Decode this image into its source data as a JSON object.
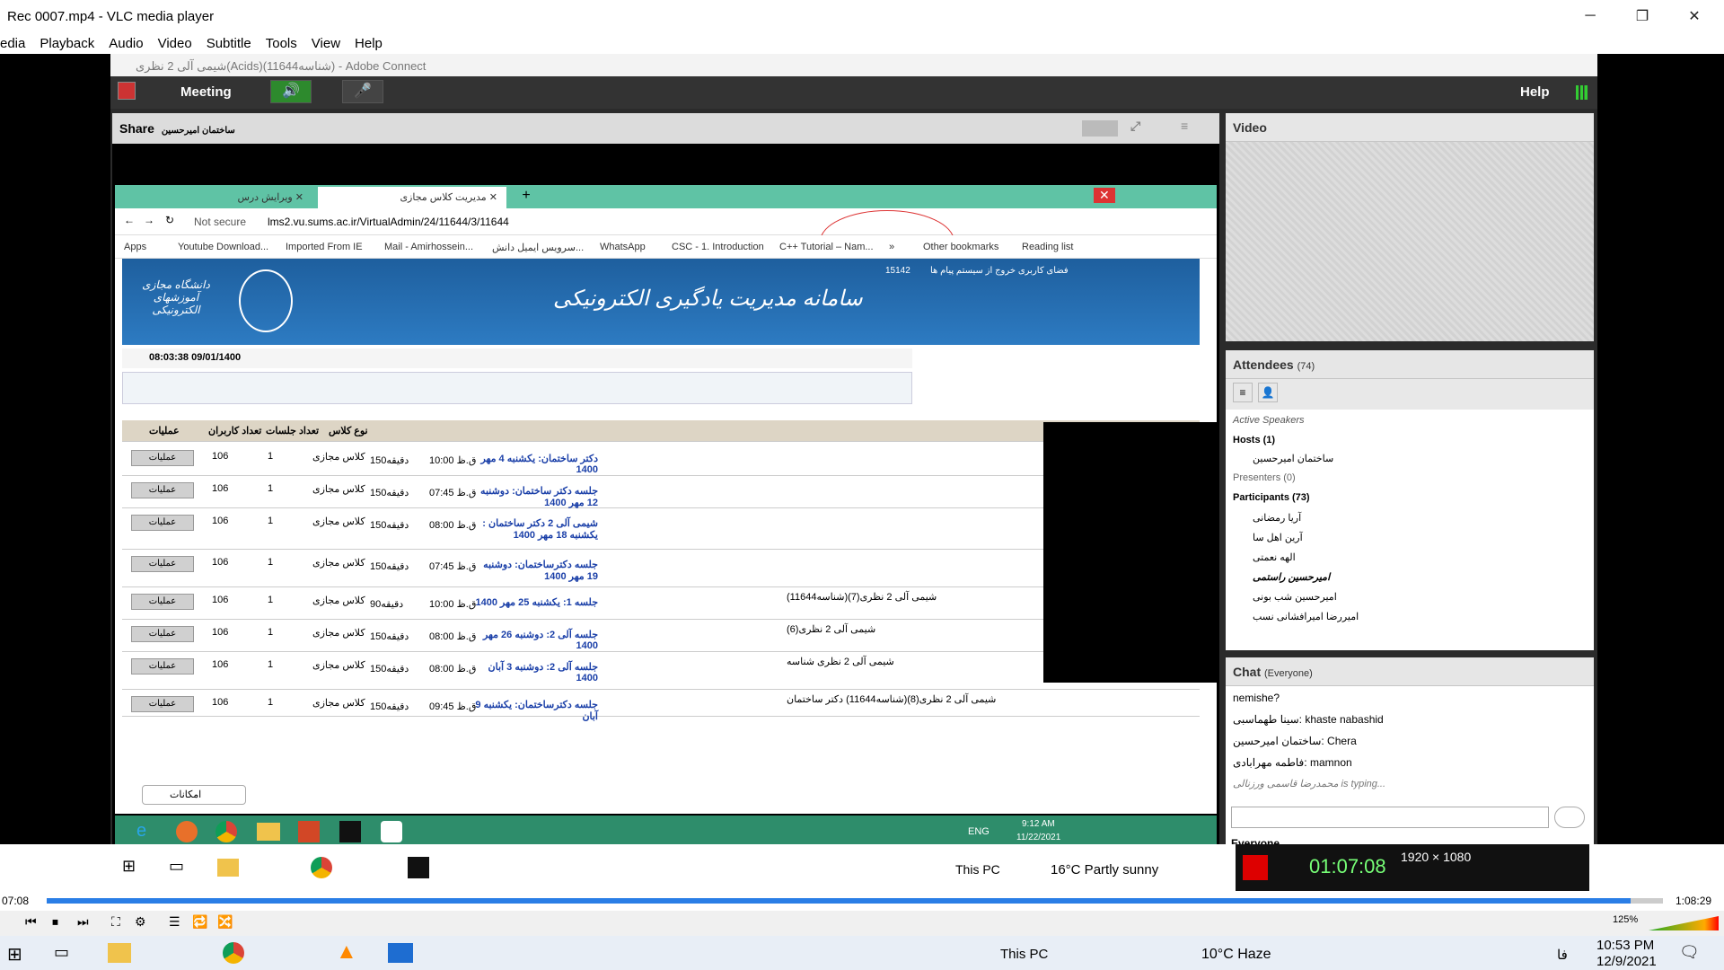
{
  "window": {
    "title": "Rec 0007.mp4 - VLC media player",
    "controls": [
      "─",
      "❐",
      "✕"
    ]
  },
  "menu": [
    "edia",
    "Playback",
    "Audio",
    "Video",
    "Subtitle",
    "Tools",
    "View",
    "Help"
  ],
  "adobe": {
    "title": "شیمی آلی 2 نظری(Acids)(شناسه11644) - Adobe Connect",
    "meeting": "Meeting",
    "help": "Help",
    "share": {
      "label": "Share",
      "presenter": "ساختمان امیرحسین"
    },
    "video_label": "Video",
    "attendees": {
      "label": "Attendees",
      "count": "(74)",
      "active_speakers": "Active Speakers",
      "hosts": "Hosts (1)",
      "host_names": [
        "ساختمان امیرحسین"
      ],
      "presenters": "Presenters (0)",
      "participants": "Participants (73)",
      "participant_names": [
        "آریا رمضانی",
        "آرین اهل سا",
        "الهه نعمتی",
        "امیرحسین راستمی",
        "امیرحسین شب بونی",
        "امیررضا امیرافشانی نسب"
      ]
    },
    "chat": {
      "label": "Chat",
      "scope": "(Everyone)",
      "lines": [
        {
          "name": "",
          "text": "nemishe?"
        },
        {
          "name": "سینا طهماسبی:",
          "text": " khaste nabashid"
        },
        {
          "name": "ساختمان امیرحسین:",
          "text": " Chera"
        },
        {
          "name": "فاطمه مهرابادی:",
          "text": " mamnon"
        },
        {
          "name": "محمدرضا قاسمی ورزنالی",
          "text": " is typing..."
        }
      ],
      "target": "Everyone"
    },
    "recorder": {
      "resolution": "1920 × 1080",
      "time": "01:07:08"
    }
  },
  "browser": {
    "tabs": [
      {
        "label": "ویرایش درس"
      },
      {
        "label": "مدیریت کلاس مجازی"
      }
    ],
    "address": {
      "secure": "Not secure",
      "url": "lms2.vu.sums.ac.ir/VirtualAdmin/24/11644/3/11644"
    },
    "bookmarks": [
      "Apps",
      "Youtube Download...",
      "Imported From IE",
      "Mail - Amirhossein...",
      "سرویس ایمیل دانش...",
      "WhatsApp",
      "CSC - 1. Introduction",
      "C++ Tutorial – Nam...",
      "»",
      "Other bookmarks",
      "Reading list"
    ],
    "banner": {
      "title": "سامانه مدیریت یادگیری الکترونیکی",
      "logo_text": "دانشگاه مجازی آموزشهای الکترونیکی",
      "links": "فضای کاربری   خروج از سیستم   پیام ها",
      "code": "15142"
    },
    "datetime": "08:03:38 09/01/1400",
    "table": {
      "headers": [
        "عملیات",
        "تعداد کاربران",
        "تعداد جلسات",
        "نوع کلاس"
      ],
      "op_label": "عملیات",
      "rows": [
        {
          "users": "106",
          "sessions": "1",
          "type": "کلاس مجازی",
          "dur": "150دقیقه",
          "time": "10:00 ق.ظ",
          "title": "دکتر ساختمان: یکشنبه 4 مهر 1400",
          "note": ""
        },
        {
          "users": "106",
          "sessions": "1",
          "type": "کلاس مجازی",
          "dur": "150دقیقه",
          "time": "07:45 ق.ظ",
          "title": "جلسه دکتر ساختمان: دوشنبه 12 مهر 1400",
          "note": ""
        },
        {
          "users": "106",
          "sessions": "1",
          "type": "کلاس مجازی",
          "dur": "150دقیقه",
          "time": "08:00 ق.ظ",
          "title": "شیمی آلی 2 دکتر ساختمان : یکشنبه 18 مهر 1400",
          "note": ""
        },
        {
          "users": "106",
          "sessions": "1",
          "type": "کلاس مجازی",
          "dur": "150دقیقه",
          "time": "07:45 ق.ظ",
          "title": "جلسه دکترساختمان: دوشنبه 19 مهر 1400",
          "note": ""
        },
        {
          "users": "106",
          "sessions": "1",
          "type": "کلاس مجازی",
          "dur": "90دقیقه",
          "time": "10:00 ق.ظ",
          "title": "جلسه 1: یکشنبه 25 مهر 1400",
          "note": "شیمی آلی 2 نظری(7)(شناسه11644)"
        },
        {
          "users": "106",
          "sessions": "1",
          "type": "کلاس مجازی",
          "dur": "150دقیقه",
          "time": "08:00 ق.ظ",
          "title": "جلسه آلی 2: دوشنبه 26 مهر 1400",
          "note": "شیمی آلی 2 نظری(6)"
        },
        {
          "users": "106",
          "sessions": "1",
          "type": "کلاس مجازی",
          "dur": "150دقیقه",
          "time": "08:00 ق.ظ",
          "title": "جلسه آلی 2: دوشنبه 3 آبان 1400",
          "note": "شیمی آلی 2 نظری شناسه"
        },
        {
          "users": "106",
          "sessions": "1",
          "type": "کلاس مجازی",
          "dur": "150دقیقه",
          "time": "09:45 ق.ظ",
          "title": "جلسه دکترساختمان: یکشنبه 9 آبان",
          "note": "شیمی آلی 2 نظری(8)(شناسه11644) دکتر ساختمان"
        }
      ]
    },
    "features": "امکانات",
    "guest_taskbar": {
      "lang": "ENG",
      "time": "9:12 AM",
      "date": "11/22/2021"
    }
  },
  "host_taskbar": {
    "thispc": "This PC",
    "weather": "16°C  Partly sunny"
  },
  "vlc": {
    "elapsed": "07:08",
    "total": "1:08:29",
    "volume": "125%",
    "progress": 0.98
  },
  "win_taskbar": {
    "thispc": "This PC",
    "weather": "10°C  Haze",
    "lang": "فا",
    "time": "10:53 PM",
    "date": "12/9/2021"
  }
}
